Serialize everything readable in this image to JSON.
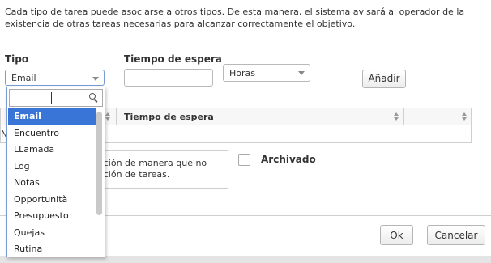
{
  "info": {
    "text": "Cada tipo de tarea puede asociarse a otros tipos. De esta manera, el sistema avisará al operador de la existencia de otras tareas necesarias para alcanzar correctamente el objetivo."
  },
  "form": {
    "tipo_label": "Tipo",
    "tipo_value": "Email",
    "tiempo_label": "Tiempo de espera",
    "tiempo_value": "",
    "unidad_value": "Horas",
    "add_label": "Añadir"
  },
  "grid": {
    "columns": [
      "",
      "Tiempo de espera"
    ],
    "row_partial": "N"
  },
  "note": {
    "text": "ación de manera que no ación de tareas."
  },
  "archivado_label": "Archivado",
  "dropdown": {
    "search_value": "",
    "items": [
      "Email",
      "Encuentro",
      "LLamada",
      "Log",
      "Notas",
      "Opportunità",
      "Presupuesto",
      "Quejas",
      "Rutina"
    ],
    "selected_index": 0
  },
  "footer": {
    "ok_label": "Ok",
    "cancel_label": "Cancelar"
  }
}
